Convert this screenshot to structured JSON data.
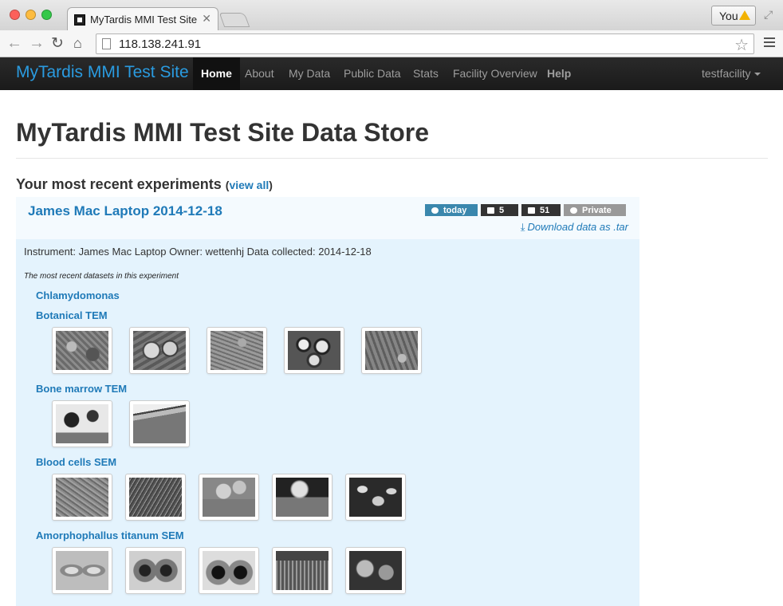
{
  "browser": {
    "tab_title": "MyTardis MMI Test Site",
    "tab_close": "✕",
    "url": "118.138.241.91",
    "profile_button": "You"
  },
  "navbar": {
    "brand": "MyTardis MMI Test Site",
    "links": [
      "Home",
      "About",
      "My Data",
      "Public Data",
      "Stats",
      "Facility Overview",
      "Help"
    ],
    "active": "Home",
    "user": "testfacility"
  },
  "page": {
    "heading": "MyTardis MMI Test Site Data Store",
    "section_title": "Your most recent experiments",
    "view_all_open": "(",
    "view_all": "view all",
    "view_all_close": ")"
  },
  "experiment": {
    "title": "James Mac Laptop 2014-12-18",
    "badges": {
      "date": "today",
      "datasets": "5",
      "datafiles": "51",
      "visibility": "Private"
    },
    "download": "Download data as .tar",
    "meta": "Instrument: James Mac Laptop Owner: wettenhj Data collected: 2014-12-18",
    "recent_note": "The most recent datasets in this experiment",
    "datasets": [
      {
        "title": "Chlamydomonas",
        "thumbnails": 0
      },
      {
        "title": "Botanical TEM",
        "thumbnails": 5
      },
      {
        "title": "Bone marrow TEM",
        "thumbnails": 2
      },
      {
        "title": "Blood cells SEM",
        "thumbnails": 5
      },
      {
        "title": "Amorphophallus titanum SEM",
        "thumbnails": 5
      }
    ]
  },
  "colors": {
    "link": "#1f7ab8",
    "brand": "#2a9be0",
    "navbar": "#1f1f1f",
    "exp_body_bg": "#e4f3fd",
    "badge_date": "#3a87ad",
    "badge_dark": "#333333",
    "badge_private": "#999999"
  },
  "icons": {
    "back": "arrow-left-icon",
    "forward": "arrow-right-icon",
    "reload": "reload-icon",
    "home": "home-icon",
    "bookmark": "star-icon",
    "menu": "hamburger-icon",
    "date_badge": "clock-icon",
    "datasets_badge": "folder-icon",
    "datafiles_badge": "file-icon",
    "visibility_badge": "eye-icon",
    "download": "download-icon"
  }
}
